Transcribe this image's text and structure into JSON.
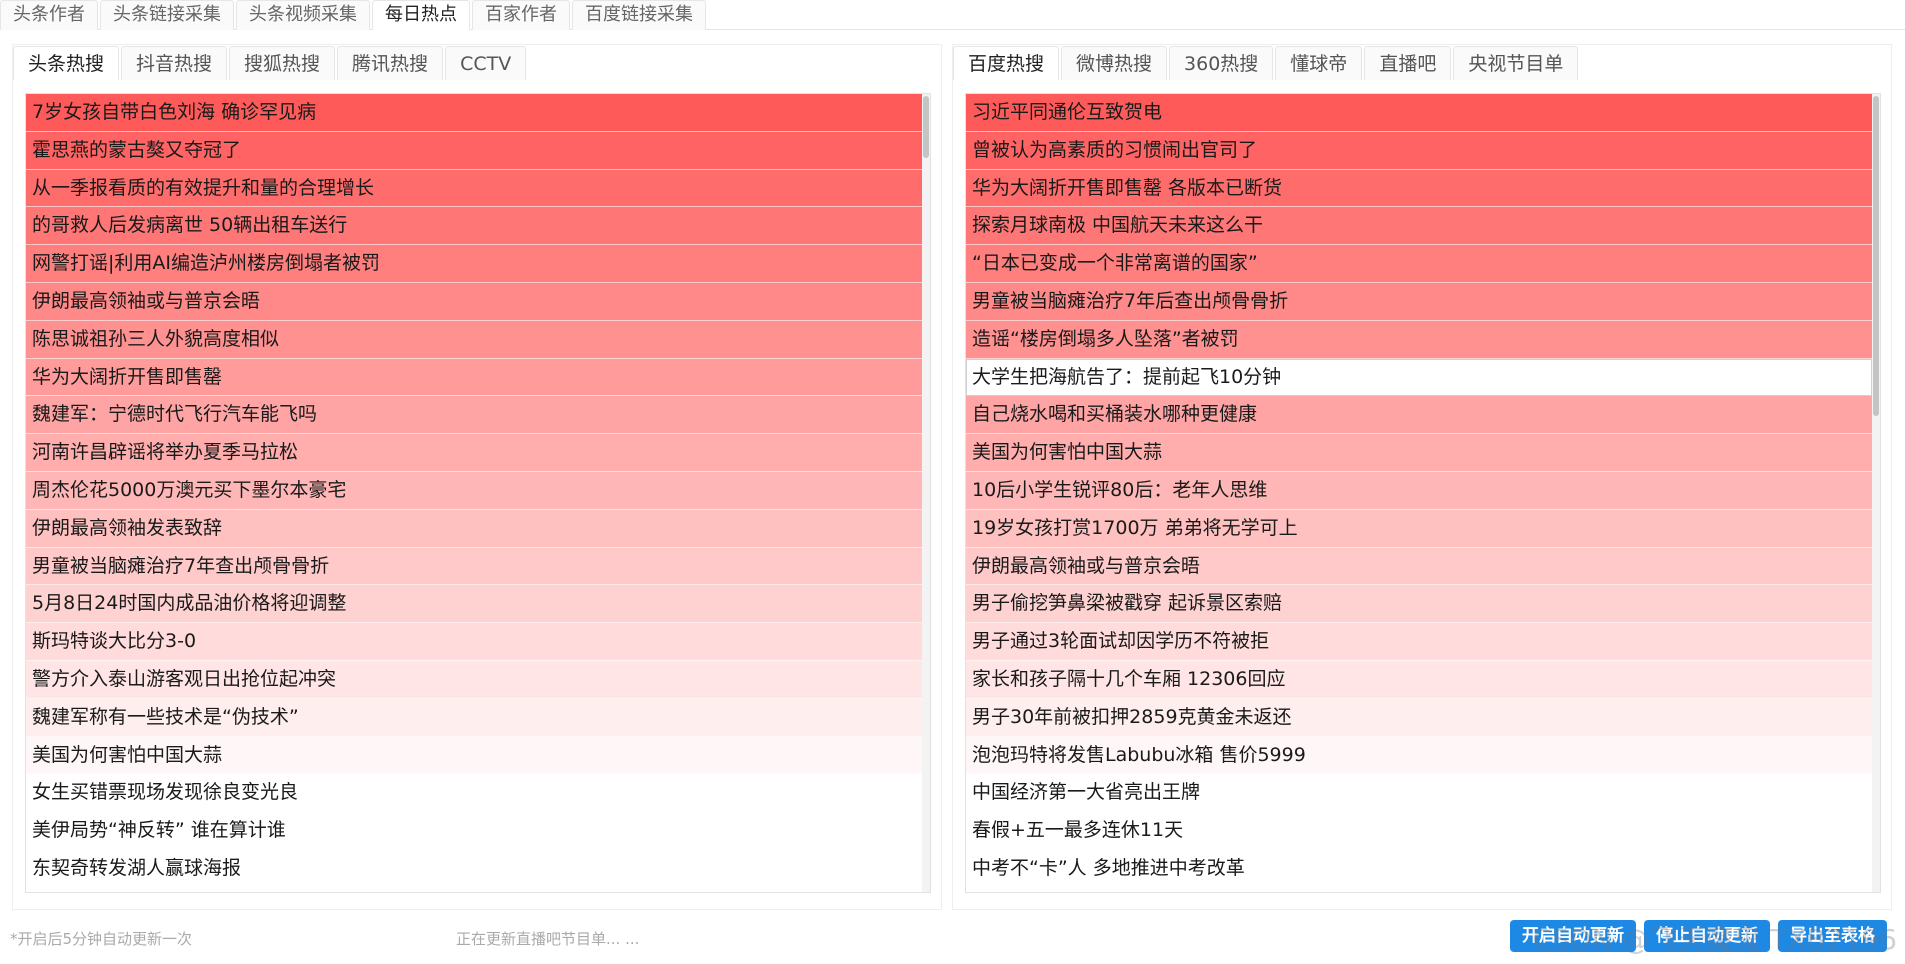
{
  "top_tabs": [
    "头条作者",
    "头条链接采集",
    "头条视频采集",
    "每日热点",
    "百家作者",
    "百度链接采集"
  ],
  "top_active": 3,
  "left_panel": {
    "tabs": [
      "头条热搜",
      "抖音热搜",
      "搜狐热搜",
      "腾讯热搜",
      "CCTV"
    ],
    "active": 0,
    "items": [
      "7岁女孩自带白色刘海 确诊罕见病",
      "霍思燕的蒙古獒又夺冠了",
      "从一季报看质的有效提升和量的合理增长",
      "的哥救人后发病离世 50辆出租车送行",
      "网警打谣|利用AI编造泸州楼房倒塌者被罚",
      "伊朗最高领袖或与普京会晤",
      "陈思诚祖孙三人外貌高度相似",
      "华为大阔折开售即售罄",
      "魏建军：宁德时代飞行汽车能飞吗",
      "河南许昌辟谣将举办夏季马拉松",
      "周杰伦花5000万澳元买下墨尔本豪宅",
      "伊朗最高领袖发表致辞",
      "男童被当脑瘫治疗7年查出颅骨骨折",
      "5月8日24时国内成品油价格将迎调整",
      "斯玛特谈大比分3-0",
      "警方介入泰山游客观日出抢位起冲突",
      "魏建军称有一些技术是“伪技术”",
      "美国为何害怕中国大蒜",
      "女生买错票现场发现徐良变光良",
      "美伊局势“神反转” 谁在算计谁",
      "东契奇转发湖人赢球海报"
    ]
  },
  "right_panel": {
    "tabs": [
      "百度热搜",
      "微博热搜",
      "360热搜",
      "懂球帝",
      "直播吧",
      "央视节目单"
    ],
    "active": 0,
    "selected_index": 7,
    "items": [
      "习近平同通伦互致贺电",
      "曾被认为高素质的习惯闹出官司了",
      "华为大阔折开售即售罄 各版本已断货",
      "探索月球南极 中国航天未来这么干",
      "“日本已变成一个非常离谱的国家”",
      "男童被当脑瘫治疗7年后查出颅骨骨折",
      "造谣“楼房倒塌多人坠落”者被罚",
      "大学生把海航告了：提前起飞10分钟",
      "自己烧水喝和买桶装水哪种更健康",
      "美国为何害怕中国大蒜",
      "10后小学生锐评80后：老年人思维",
      "19岁女孩打赏1700万 弟弟将无学可上",
      "伊朗最高领袖或与普京会晤",
      "男子偷挖笋鼻梁被戳穿 起诉景区索赔",
      "男子通过3轮面试却因学历不符被拒",
      "家长和孩子隔十几个车厢 12306回应",
      "男子30年前被扣押2859克黄金未返还",
      "泡泡玛特将发售Labubu冰箱 售价5999",
      "中国经济第一大省亮出王牌",
      "春假+五一最多连休11天",
      "中考不“卡”人 多地推进中考改革"
    ]
  },
  "footer": {
    "note_left": "*开启后5分钟自动更新一次",
    "note_center": "正在更新直播吧节目单... ...",
    "btn_start": "开启自动更新",
    "btn_stop": "停止自动更新",
    "btn_export": "导出至表格",
    "watermark": "CSDN @飞天魔鬼 TXB2196"
  },
  "colors": {
    "hot_top": "#ff5a5a",
    "hot_bottom": "#ffffff",
    "button_blue": "#1e88e5"
  }
}
